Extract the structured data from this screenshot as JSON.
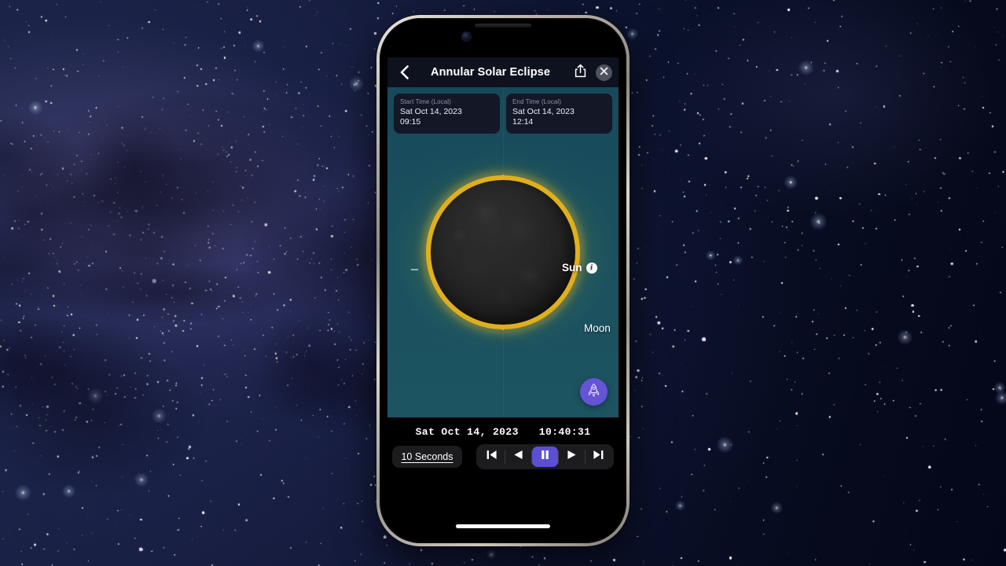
{
  "app": {
    "header": {
      "back_icon": "chevron-left-icon",
      "title": "Annular Solar Eclipse",
      "share_icon": "share-icon",
      "close_icon": "close-icon"
    },
    "cards": [
      {
        "label": "Start Time (Local)",
        "date": "Sat Oct 14, 2023",
        "time": "09:15"
      },
      {
        "label": "End Time (Local)",
        "date": "Sat Oct 14, 2023",
        "time": "12:14"
      }
    ],
    "sky": {
      "sun_label": "Sun",
      "info_icon_glyph": "i",
      "moon_label": "Moon",
      "rocket_icon": "rocket-icon",
      "background_color": "#1a4f5e",
      "sun_ring_color": "#e0ae1c",
      "moon_color": "#272727",
      "accent_color": "#6454d6"
    },
    "playback": {
      "date": "Sat Oct 14, 2023",
      "time": "10:40:31",
      "step_label": "10 Seconds",
      "buttons": [
        {
          "name": "skip-back-button",
          "label": "skip-backward-icon",
          "active": false
        },
        {
          "name": "rewind-button",
          "label": "rewind-icon",
          "active": false
        },
        {
          "name": "pause-button",
          "label": "pause-icon",
          "active": true
        },
        {
          "name": "play-button",
          "label": "play-icon",
          "active": false
        },
        {
          "name": "skip-forward-button",
          "label": "skip-forward-icon",
          "active": false
        }
      ]
    }
  }
}
